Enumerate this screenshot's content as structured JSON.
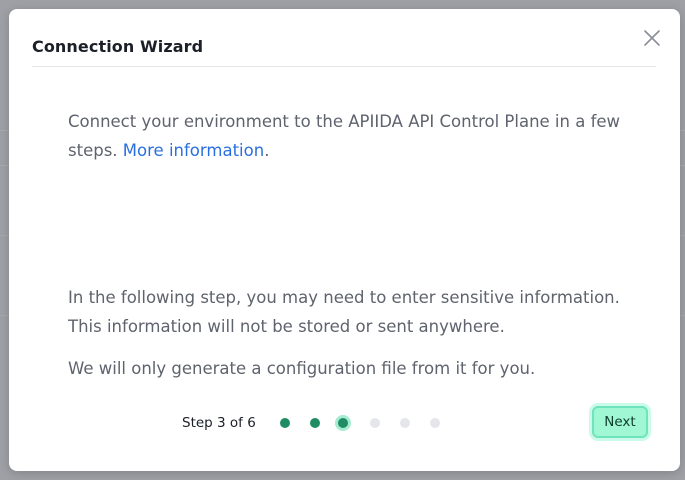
{
  "dialog": {
    "title": "Connection Wizard",
    "close_icon": "close-icon"
  },
  "intro": {
    "text": "Connect your environment to the APIIDA API Control Plane in a few steps.",
    "link_label": "More information",
    "trailing": "."
  },
  "notes": {
    "sensitive": "In the following step, you may need to enter sensitive information. This information will not be stored or sent anywhere.",
    "generate": "We will only generate a configuration file from it for you."
  },
  "stepper": {
    "label": "Step 3 of 6",
    "current": 3,
    "total": 6
  },
  "footer": {
    "next_label": "Next"
  },
  "colors": {
    "accent": "#1f8c64",
    "link": "#2a6fe0",
    "button_bg": "#9ff7d4"
  }
}
